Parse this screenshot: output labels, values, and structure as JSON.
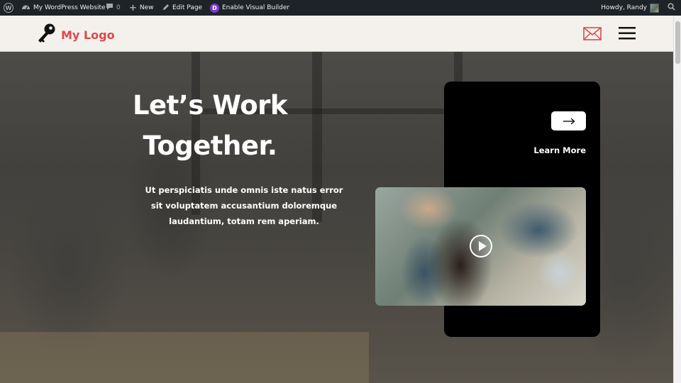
{
  "admin_bar": {
    "site_name": "My WordPress Website",
    "comments_count": "0",
    "new_label": "New",
    "edit_label": "Edit Page",
    "visual_builder_label": "Enable Visual Builder",
    "greeting": "Howdy, Randy"
  },
  "header": {
    "logo_text": "My Logo",
    "accent_color": "#e0484c"
  },
  "hero": {
    "title_line1": "Let’s Work",
    "title_line2": "Together.",
    "body": "Ut perspiciatis unde omnis iste natus error sit voluptatem accusantium doloremque laudantium, totam rem aperiam."
  },
  "card": {
    "cta_label": "Learn More"
  }
}
